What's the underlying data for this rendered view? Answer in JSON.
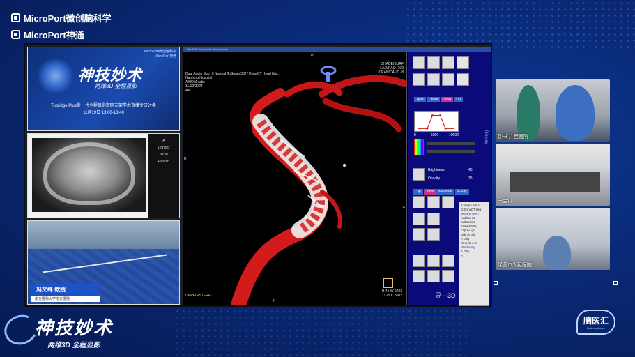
{
  "brand": {
    "line1": "MicroPort微创脑科学",
    "line2": "MicroPort神通"
  },
  "thumbs": {
    "poster": {
      "logo_line1": "MicroPort微创脑科学",
      "logo_line2": "MicroPort神通",
      "title": "神技妙术",
      "subtitle": "两维3D 全程显影",
      "event": "Tubridge Plus新一代全程显影密网支架学术直播专研讨会",
      "time": "11月19日 13:00-18:40"
    },
    "xray": {
      "side_labels": [
        "A",
        "Conflict",
        "00:00",
        "Restart"
      ]
    },
    "surgery": {
      "name": "冯文峰 教授",
      "hospital": "南方医科大学南方医院"
    }
  },
  "viewer": {
    "menubar": "File  Edit  View  Tools  Window  Help",
    "overlay_tl": [
      "Dual Angio Sub Hi Normal [InSpace3D] / DynaCT Head Nat...",
      "Nanfang Hospital",
      "AXIOM-Artis",
      "11/19/2024",
      "AX"
    ],
    "overlay_tr": [
      "SHADE/SURF",
      "LAO/RAO  -109",
      "CRAN/CAUD  -8"
    ],
    "overlay_br": [
      "B  45   W  9223",
      "O  25   C  8602"
    ],
    "overlay_bl": "UNREGISTERED",
    "orient_top": "H",
    "orient_bottom": "F",
    "orient_left": "R",
    "orient_right": "A"
  },
  "panel": {
    "tabs1": [
      "Type",
      "Orient",
      "Table",
      "LO"
    ],
    "axis_ticks": [
      "0",
      "5000",
      "10000"
    ],
    "brightness_label": "Brightness",
    "brightness_value": "45",
    "opacity_label": "Opacity",
    "opacity_value": "25",
    "tabs2": [
      "Clip",
      "Tools",
      "Measure",
      "X-Ray"
    ],
    "side_label": "Display",
    "bottom_text": "导---3D"
  },
  "popup": {
    "lines": [
      "A: Angio Sub H",
      "B: DynaCT Hea",
      "",
      "Merging Meth",
      "Addition (4",
      "Subtraction",
      "Embedded (",
      "Clipped (B",
      "Side by Sid",
      "A Only",
      "Reverse A 8",
      "",
      "Windowing",
      "A Only",
      "A"
    ]
  },
  "cams": {
    "cam1_label": "钟书 广西医院",
    "cam2_label": "一会议",
    "cam3_label": "绿营市人民医院"
  },
  "bottom_logo": {
    "title": "神技妙术",
    "subtitle": "两维3D 全程显影"
  },
  "corner_logo": {
    "cn": "脑医汇",
    "en": "Brainmed.com"
  },
  "colors": {
    "background": "#0a2a78",
    "vessel_red": "#d21b1b",
    "stent": "#e8e8e8",
    "panel_blue": "#0a0a7a",
    "tab_active": "#cc2d8a",
    "name_bar": "#1c52c8"
  }
}
